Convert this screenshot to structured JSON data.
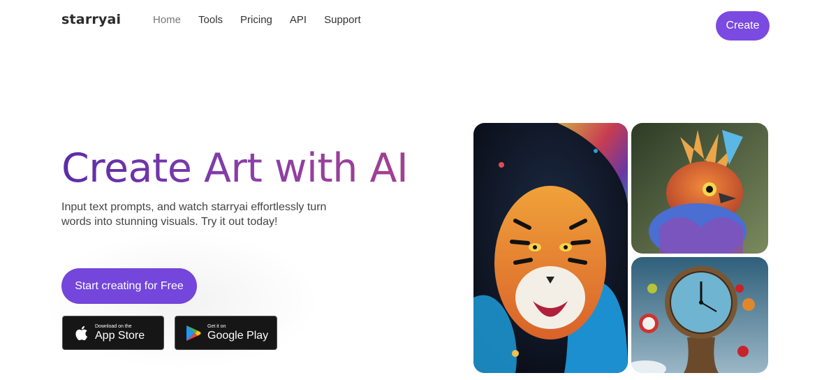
{
  "brand": {
    "name": "starryai"
  },
  "nav": {
    "items": [
      {
        "label": "Home"
      },
      {
        "label": "Tools"
      },
      {
        "label": "Pricing"
      },
      {
        "label": "API"
      },
      {
        "label": "Support"
      }
    ],
    "create_label": "Create"
  },
  "hero": {
    "title": "Create Art with AI",
    "subtitle": "Input text prompts, and watch starryai effortlessly turn words into stunning visuals. Try it out today!",
    "cta_label": "Start creating for Free"
  },
  "stores": {
    "apple": {
      "small": "Download on the",
      "big": "App Store",
      "icon": "apple-icon"
    },
    "google": {
      "small": "Get it on",
      "big": "Google Play",
      "icon": "google-play-icon"
    }
  },
  "colors": {
    "accent": "#7446dc",
    "title_gradient_start": "#5a2ca8",
    "title_gradient_end": "#a3408f"
  }
}
